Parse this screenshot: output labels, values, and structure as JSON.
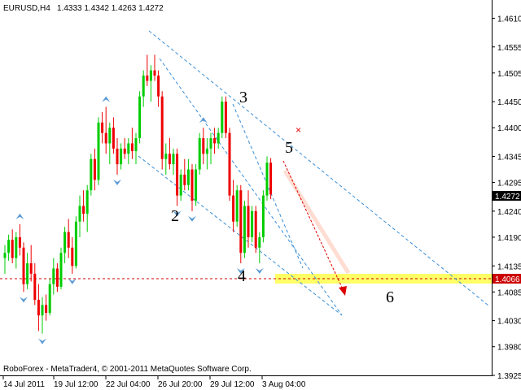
{
  "header": {
    "symbol": "EURUSD,H4",
    "ohlc": "1.4333 1.4342 1.4263 1.4272"
  },
  "footer": {
    "copyright": "RoboForex - MetaTrader4, © 2001-2011 MetaQuotes Software Corp."
  },
  "colors": {
    "background": "#ffffff",
    "bull": "#00cc00",
    "bear": "#ee0000",
    "fractal": "#5b9bd5",
    "channel": "#3a8fd8",
    "target_zone": "#ffff66",
    "target_line": "#cc0000",
    "forecast_arrow": "#dd0000",
    "price_tag_bg": "#000000",
    "price_tag_text": "#ffffff",
    "target_tag_bg": "#cc0000"
  },
  "chart_data": {
    "type": "candlestick",
    "ylim": [
      1.3925,
      1.4645
    ],
    "y_ticks": [
      "1.4610",
      "1.4555",
      "1.4505",
      "1.4450",
      "1.4400",
      "1.4345",
      "1.4295",
      "1.4240",
      "1.4190",
      "1.4135",
      "1.4085",
      "1.4030",
      "1.3980",
      "1.3925"
    ],
    "x_tick_labels": [
      "14 Jul 2011",
      "19 Jul 12:00",
      "22 Jul 04:00",
      "26 Jul 20:00",
      "29 Jul 12:00",
      "3 Aug 04:00"
    ],
    "current_price": "1.4272",
    "target_price": "1.4066",
    "wave_labels": [
      "2",
      "3",
      "4",
      "5",
      "6"
    ],
    "candles": [
      [
        1.415,
        1.4175,
        1.412,
        1.416
      ],
      [
        1.416,
        1.4195,
        1.4145,
        1.4185
      ],
      [
        1.4185,
        1.4205,
        1.414,
        1.415
      ],
      [
        1.415,
        1.42,
        1.413,
        1.419
      ],
      [
        1.419,
        1.4215,
        1.4155,
        1.417
      ],
      [
        1.417,
        1.418,
        1.4085,
        1.41
      ],
      [
        1.41,
        1.416,
        1.409,
        1.414
      ],
      [
        1.414,
        1.4175,
        1.4105,
        1.412
      ],
      [
        1.412,
        1.414,
        1.406,
        1.407
      ],
      [
        1.407,
        1.41,
        1.401,
        1.404
      ],
      [
        1.404,
        1.4075,
        1.4005,
        1.406
      ],
      [
        1.406,
        1.408,
        1.403,
        1.4045
      ],
      [
        1.4045,
        1.411,
        1.404,
        1.41
      ],
      [
        1.41,
        1.415,
        1.408,
        1.413
      ],
      [
        1.413,
        1.414,
        1.4085,
        1.4095
      ],
      [
        1.4095,
        1.417,
        1.409,
        1.416
      ],
      [
        1.416,
        1.421,
        1.414,
        1.42
      ],
      [
        1.42,
        1.4225,
        1.415,
        1.417
      ],
      [
        1.417,
        1.419,
        1.412,
        1.4135
      ],
      [
        1.4135,
        1.423,
        1.413,
        1.422
      ],
      [
        1.422,
        1.427,
        1.419,
        1.425
      ],
      [
        1.425,
        1.428,
        1.422,
        1.4235
      ],
      [
        1.4235,
        1.429,
        1.42,
        1.428
      ],
      [
        1.428,
        1.435,
        1.427,
        1.434
      ],
      [
        1.434,
        1.436,
        1.428,
        1.43
      ],
      [
        1.43,
        1.442,
        1.429,
        1.441
      ],
      [
        1.441,
        1.443,
        1.437,
        1.439
      ],
      [
        1.439,
        1.444,
        1.435,
        1.437
      ],
      [
        1.437,
        1.441,
        1.433,
        1.44
      ],
      [
        1.44,
        1.442,
        1.435,
        1.436
      ],
      [
        1.436,
        1.438,
        1.431,
        1.433
      ],
      [
        1.433,
        1.437,
        1.432,
        1.436
      ],
      [
        1.436,
        1.438,
        1.434,
        1.435
      ],
      [
        1.435,
        1.438,
        1.433,
        1.437
      ],
      [
        1.437,
        1.44,
        1.434,
        1.4355
      ],
      [
        1.4355,
        1.439,
        1.433,
        1.438
      ],
      [
        1.438,
        1.447,
        1.437,
        1.446
      ],
      [
        1.446,
        1.451,
        1.444,
        1.45
      ],
      [
        1.45,
        1.454,
        1.448,
        1.449
      ],
      [
        1.449,
        1.452,
        1.445,
        1.451
      ],
      [
        1.451,
        1.454,
        1.449,
        1.45
      ],
      [
        1.45,
        1.451,
        1.444,
        1.446
      ],
      [
        1.446,
        1.447,
        1.432,
        1.434
      ],
      [
        1.434,
        1.437,
        1.431,
        1.435
      ],
      [
        1.435,
        1.438,
        1.432,
        1.433
      ],
      [
        1.433,
        1.436,
        1.431,
        1.435
      ],
      [
        1.435,
        1.436,
        1.425,
        1.427
      ],
      [
        1.427,
        1.432,
        1.426,
        1.431
      ],
      [
        1.431,
        1.434,
        1.428,
        1.429
      ],
      [
        1.429,
        1.434,
        1.428,
        1.432
      ],
      [
        1.432,
        1.433,
        1.424,
        1.426
      ],
      [
        1.426,
        1.433,
        1.425,
        1.432
      ],
      [
        1.432,
        1.439,
        1.431,
        1.438
      ],
      [
        1.438,
        1.44,
        1.433,
        1.435
      ],
      [
        1.435,
        1.438,
        1.432,
        1.436
      ],
      [
        1.436,
        1.439,
        1.433,
        1.438
      ],
      [
        1.438,
        1.44,
        1.435,
        1.437
      ],
      [
        1.437,
        1.44,
        1.436,
        1.439
      ],
      [
        1.439,
        1.446,
        1.438,
        1.445
      ],
      [
        1.445,
        1.446,
        1.438,
        1.439
      ],
      [
        1.439,
        1.44,
        1.426,
        1.427
      ],
      [
        1.427,
        1.43,
        1.42,
        1.422
      ],
      [
        1.422,
        1.429,
        1.421,
        1.428
      ],
      [
        1.428,
        1.429,
        1.414,
        1.416
      ],
      [
        1.416,
        1.426,
        1.415,
        1.425
      ],
      [
        1.425,
        1.428,
        1.417,
        1.419
      ],
      [
        1.419,
        1.425,
        1.418,
        1.424
      ],
      [
        1.424,
        1.425,
        1.416,
        1.417
      ],
      [
        1.417,
        1.42,
        1.414,
        1.419
      ],
      [
        1.419,
        1.428,
        1.418,
        1.427
      ],
      [
        1.427,
        1.4345,
        1.426,
        1.4333
      ],
      [
        1.4333,
        1.4342,
        1.4263,
        1.4272
      ]
    ]
  }
}
